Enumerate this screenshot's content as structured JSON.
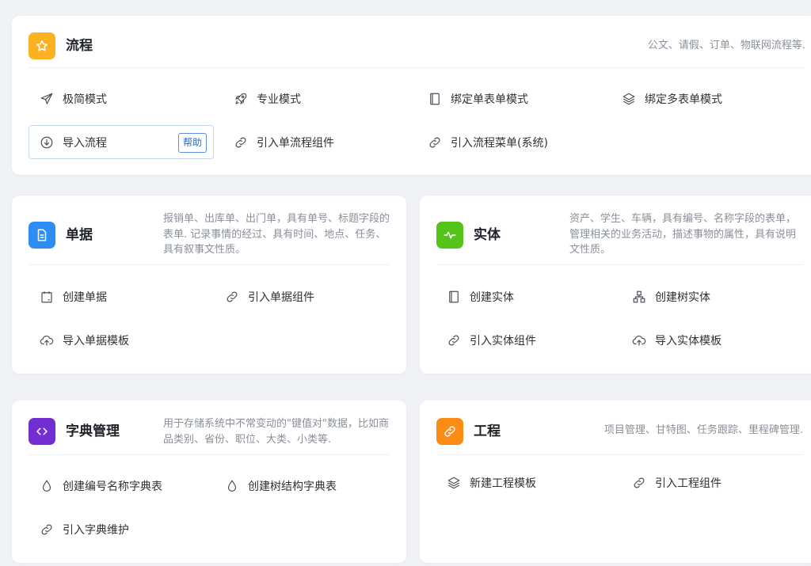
{
  "colors": {
    "flow": "#fdb022",
    "document": "#2e8df5",
    "entity": "#52c41a",
    "dictionary": "#722ed1",
    "project": "#fa8c16",
    "link": "#2b6cc4"
  },
  "flow": {
    "title": "流程",
    "icon": "star-icon",
    "description": "公文、请假、订单、物联网流程等.",
    "actions": {
      "simple": "极简模式",
      "pro": "专业模式",
      "bind_single": "绑定单表单模式",
      "bind_multi": "绑定多表单模式",
      "import": "导入流程",
      "help": "帮助",
      "single_component": "引入单流程组件",
      "menu": "引入流程菜单(系统)"
    }
  },
  "document": {
    "title": "单据",
    "icon": "document-icon",
    "description": "报销单、出库单、出门单，具有单号、标题字段的表单. 记录事情的经过、具有时间、地点、任务、具有叙事文性质。",
    "actions": {
      "create": "创建单据",
      "component": "引入单据组件",
      "import_template": "导入单据模板"
    }
  },
  "entity": {
    "title": "实体",
    "icon": "pulse-icon",
    "description": "资产、学生、车辆，具有编号、名称字段的表单，管理相关的业务活动，描述事物的属性，具有说明文性质。",
    "actions": {
      "create": "创建实体",
      "create_tree": "创建树实体",
      "component": "引入实体组件",
      "import_template": "导入实体模板"
    }
  },
  "dictionary": {
    "title": "字典管理",
    "icon": "code-icon",
    "description": "用于存储系统中不常变动的\"键值对\"数据，比如商品类别、省份、职位、大类、小类等.",
    "actions": {
      "create_code": "创建编号名称字典表",
      "create_tree": "创建树结构字典表",
      "maintain": "引入字典维护"
    }
  },
  "project": {
    "title": "工程",
    "icon": "link-icon",
    "description": "项目管理、甘特图、任务跟踪、里程碑管理.",
    "actions": {
      "new_template": "新建工程模板",
      "component": "引入工程组件"
    }
  }
}
